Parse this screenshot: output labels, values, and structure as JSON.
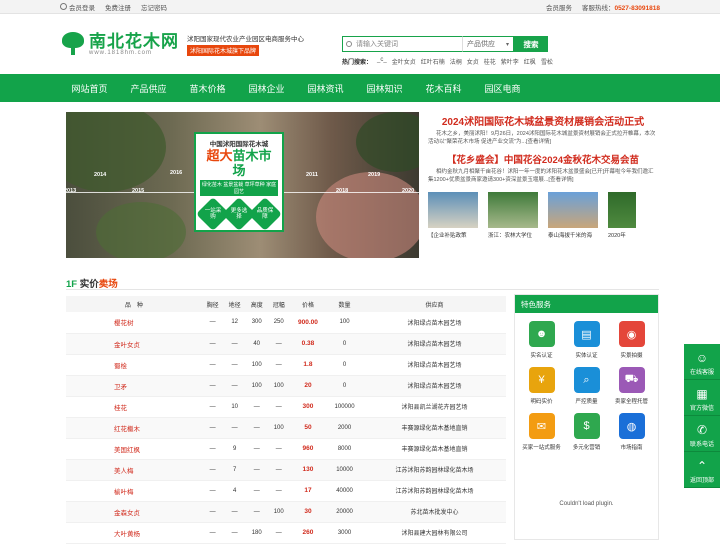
{
  "topbar": {
    "login": "会员登录",
    "register": "免费注册",
    "forgot": "忘记密码",
    "service": "会员服务",
    "hotline_label": "客服热线：",
    "hotline": "0527-83091818"
  },
  "header": {
    "logo_cn": "南北花木网",
    "logo_url": "www.1818hm.com",
    "slogan": "沭阳国家现代农业产业园区电商服务中心",
    "slogan_tag": "沭阳国际花木城旗下品牌"
  },
  "search": {
    "placeholder": "请输入关键词",
    "category": "产品供应",
    "button": "搜索",
    "hot_label": "热门搜索：",
    "hot_words": [
      "_c_",
      "金叶女贞",
      "红叶石楠",
      "法桐",
      "女贞",
      "桂花",
      "紫叶李",
      "红枫",
      "雪松"
    ]
  },
  "nav": [
    "网站首页",
    "产品供应",
    "苗木价格",
    "园林企业",
    "园林资讯",
    "园林知识",
    "花木百科",
    "园区电商"
  ],
  "banner": {
    "years": [
      "2013",
      "2014",
      "2015",
      "2016",
      "2011",
      "2018",
      "2019",
      "2020"
    ],
    "promo_line1": "中国沭阳国际花木城",
    "promo_big_a": "超大",
    "promo_big_b": "苗木市场",
    "promo_strip": "绿化苗木 盆景盆栽 草坪草种 家庭园艺",
    "hex": [
      "一站采购",
      "更多选择",
      "品质保障"
    ]
  },
  "news": {
    "title1": "2024沭阳国际花木城盆景资材展销会活动正式",
    "desc1": "花木之乡，美丽沭阳！9月26日，2024沭阳国际花木城盆景资材展销会正式拉开帷幕，本次活动以\"聚荣花木市场 促进产业交流\"为...[查看详情]",
    "title2": "【花乡盛会】中国花谷2024金秋花木交易会苗",
    "desc2": "相约金秋九月相聚千亩花谷！沭阳一年一度的沭阳花木盆景盛会[已开]开幕啦今年我们邀汇集1200+优质盆景商家邀请300+资深盆景玉堰展...[查看详情]",
    "thumbs": [
      "【企业补贴政策",
      "浙江：农林大学位",
      "泰山海拔千米的海",
      "2020年"
    ]
  },
  "section": {
    "prefix": "1F",
    "title_a": "实价",
    "title_b": "卖场"
  },
  "table": {
    "headers": [
      "品　种",
      "胸径",
      "地径",
      "高度",
      "冠幅",
      "价格",
      "数量",
      "供应商"
    ],
    "rows": [
      [
        "樱花树",
        "—",
        "12",
        "300",
        "250",
        "900.00",
        "100",
        "沭阳绿点苗木园艺场"
      ],
      [
        "金叶女贞",
        "—",
        "—",
        "40",
        "—",
        "0.38",
        "0",
        "沭阳绿点苗木园艺场"
      ],
      [
        "蜀桧",
        "—",
        "—",
        "100",
        "—",
        "1.8",
        "0",
        "沭阳绿点苗木园艺场"
      ],
      [
        "卫矛",
        "—",
        "—",
        "100",
        "100",
        "20",
        "0",
        "沭阳绿点苗木园艺场"
      ],
      [
        "桂花",
        "—",
        "10",
        "—",
        "—",
        "300",
        "100000",
        "沭阳县凯兰湖花卉园艺场"
      ],
      [
        "红花檵木",
        "—",
        "—",
        "—",
        "100",
        "50",
        "2000",
        "丰赛源绿化苗木基地直销"
      ],
      [
        "美国红枫",
        "—",
        "9",
        "—",
        "—",
        "960",
        "8000",
        "丰赛源绿化苗木基地直销"
      ],
      [
        "美人梅",
        "—",
        "7",
        "—",
        "—",
        "130",
        "10000",
        "江苏沭阳苏韵园林绿化苗木场"
      ],
      [
        "榆叶梅",
        "—",
        "4",
        "—",
        "—",
        "17",
        "40000",
        "江苏沭阳苏韵园林绿化苗木场"
      ],
      [
        "金森女贞",
        "—",
        "—",
        "—",
        "100",
        "30",
        "20000",
        "苏北苗木批发中心"
      ],
      [
        "大叶黄杨",
        "—",
        "—",
        "180",
        "—",
        "260",
        "3000",
        "沭阳县建大园林有限公司"
      ]
    ]
  },
  "services": {
    "header": "特色服务",
    "items": [
      {
        "label": "实名认证",
        "color": "#2fa84f",
        "icon": "user-icon"
      },
      {
        "label": "实体认证",
        "color": "#1a8fd8",
        "icon": "building-icon"
      },
      {
        "label": "实景拍摄",
        "color": "#e4463a",
        "icon": "camera-icon"
      },
      {
        "label": "明码实价",
        "color": "#e8a40d",
        "icon": "yen-icon"
      },
      {
        "label": "严控质量",
        "color": "#1a8fd8",
        "icon": "magnifier-icon"
      },
      {
        "label": "卖家全程托管",
        "color": "#9b59b6",
        "icon": "cart-icon"
      },
      {
        "label": "买家一站式服务",
        "color": "#f39c12",
        "icon": "bell-icon"
      },
      {
        "label": "多元化营销",
        "color": "#2fa84f",
        "icon": "money-icon"
      },
      {
        "label": "市场指南",
        "color": "#1a6fd8",
        "icon": "globe-icon"
      }
    ],
    "plugin": "Couldn't load plugin."
  },
  "float_bar": [
    "在线客服",
    "官方微信",
    "联系电话",
    "返回顶部"
  ]
}
